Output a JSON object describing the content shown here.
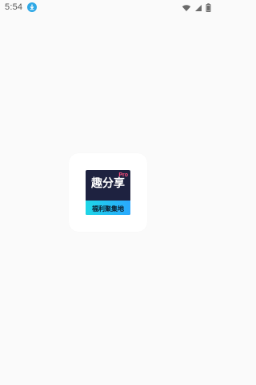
{
  "status_bar": {
    "time": "5:54",
    "icons": [
      "download-icon",
      "wifi-icon",
      "cell-signal-icon",
      "battery-icon"
    ]
  },
  "splash": {
    "logo": {
      "title": "趣分享",
      "badge": "Pro",
      "subtitle": "福利聚集地"
    }
  },
  "colors": {
    "background": "#fafafa",
    "card": "#ffffff",
    "logo_dark": "#1e2240",
    "accent_cyan": "#1ed6e6",
    "accent_pink": "#ff4d7d",
    "download_blue": "#2ea8e6"
  }
}
